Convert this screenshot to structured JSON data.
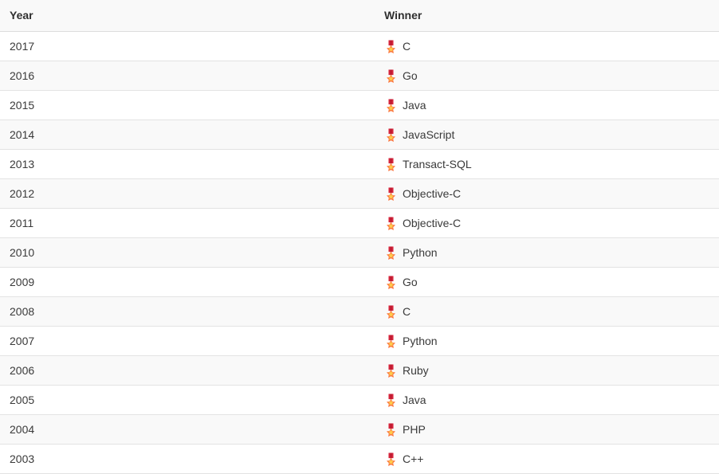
{
  "table": {
    "columns": [
      {
        "key": "year",
        "label": "Year"
      },
      {
        "key": "winner",
        "label": "Winner"
      }
    ],
    "winner_icon": "medal-icon",
    "colors": {
      "header_background": "#f9f9f9",
      "row_background_odd": "#ffffff",
      "row_background_even": "#f9f9f9",
      "row_border": "#e3e3e3",
      "header_border": "#dddddd",
      "header_text": "#2f2f2f",
      "body_text": "#3a3a3a",
      "medal_ribbon": "#dd2e44",
      "medal_star": "#fa743e",
      "medal_star_inner": "#ffcc4d"
    },
    "rows": [
      {
        "year": "2017",
        "winner": "C"
      },
      {
        "year": "2016",
        "winner": "Go"
      },
      {
        "year": "2015",
        "winner": "Java"
      },
      {
        "year": "2014",
        "winner": "JavaScript"
      },
      {
        "year": "2013",
        "winner": "Transact-SQL"
      },
      {
        "year": "2012",
        "winner": "Objective-C"
      },
      {
        "year": "2011",
        "winner": "Objective-C"
      },
      {
        "year": "2010",
        "winner": "Python"
      },
      {
        "year": "2009",
        "winner": "Go"
      },
      {
        "year": "2008",
        "winner": "C"
      },
      {
        "year": "2007",
        "winner": "Python"
      },
      {
        "year": "2006",
        "winner": "Ruby"
      },
      {
        "year": "2005",
        "winner": "Java"
      },
      {
        "year": "2004",
        "winner": "PHP"
      },
      {
        "year": "2003",
        "winner": "C++"
      }
    ]
  }
}
